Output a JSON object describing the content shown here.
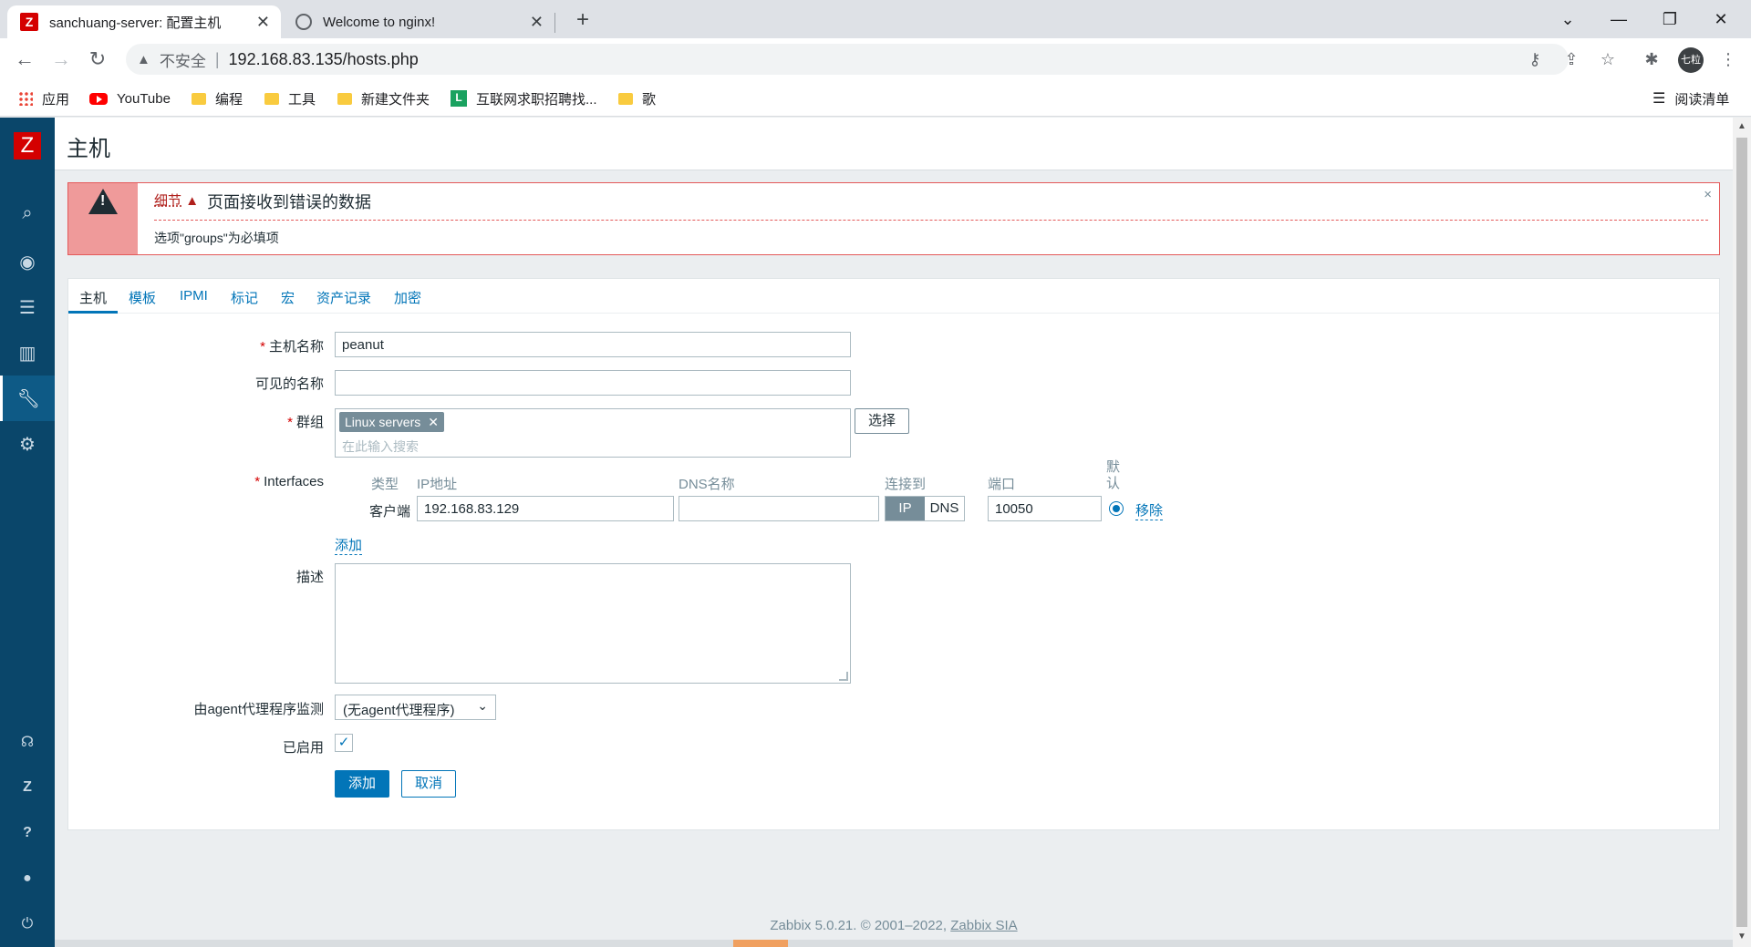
{
  "browser": {
    "tabs": [
      {
        "title": "sanchuang-server: 配置主机",
        "favicon": "zabbix-favicon",
        "active": true
      },
      {
        "title": "Welcome to nginx!",
        "favicon": "globe-icon",
        "active": false
      }
    ],
    "new_tab": "+",
    "address": {
      "security_label": "不安全",
      "separator": "|",
      "url": "192.168.83.135/hosts.php"
    },
    "profile_initials": "七粒",
    "bookmarks": [
      {
        "label": "应用",
        "icon": "apps-grid-icon"
      },
      {
        "label": "YouTube",
        "icon": "youtube-icon"
      },
      {
        "label": "编程",
        "icon": "folder-icon"
      },
      {
        "label": "工具",
        "icon": "folder-icon"
      },
      {
        "label": "新建文件夹",
        "icon": "folder-icon"
      },
      {
        "label": "互联网求职招聘找...",
        "icon": "liepin-icon"
      },
      {
        "label": "歌",
        "icon": "folder-icon"
      }
    ],
    "reading_list": "阅读清单"
  },
  "sidebar": {
    "logo": "Z",
    "items": [
      "search-icon",
      "monitoring-eye-icon",
      "inventory-list-icon",
      "reports-chart-icon",
      "configuration-wrench-icon",
      "administration-gear-icon"
    ],
    "bottom": [
      "support-icon",
      "share-icon",
      "help-icon",
      "user-icon",
      "logout-icon"
    ],
    "bottom_glyphs": {
      "share": "Z",
      "help": "?"
    }
  },
  "page": {
    "title": "主机"
  },
  "error": {
    "details_toggle": "细节",
    "details_arrow": "▲",
    "message": "页面接收到错误的数据",
    "detail": "选项\"groups\"为必填项",
    "close": "×"
  },
  "form": {
    "tabs": [
      "主机",
      "模板",
      "IPMI",
      "标记",
      "宏",
      "资产记录",
      "加密"
    ],
    "active_tab": 0,
    "required_mark": "*",
    "host_name": {
      "label": "主机名称",
      "value": "peanut"
    },
    "visible_name": {
      "label": "可见的名称",
      "value": ""
    },
    "groups": {
      "label": "群组",
      "selected": "Linux servers",
      "remove": "✕",
      "placeholder": "在此输入搜索",
      "select_button": "选择"
    },
    "interfaces": {
      "label": "Interfaces",
      "headers": {
        "type": "类型",
        "ip": "IP地址",
        "dns": "DNS名称",
        "connect": "连接到",
        "port": "端口",
        "default": "默认"
      },
      "rows": [
        {
          "type": "客户端",
          "ip": "192.168.83.129",
          "dns": "",
          "connect_options": [
            "IP",
            "DNS"
          ],
          "connect_selected": "IP",
          "port": "10050",
          "default": true,
          "remove": "移除"
        }
      ],
      "add": "添加"
    },
    "description": {
      "label": "描述",
      "value": ""
    },
    "proxy": {
      "label": "由agent代理程序监测",
      "value": "(无agent代理程序)"
    },
    "enabled": {
      "label": "已启用",
      "checked": true,
      "check_glyph": "✓"
    },
    "buttons": {
      "add": "添加",
      "cancel": "取消"
    }
  },
  "footer": {
    "text": "Zabbix 5.0.21. © 2001–2022, ",
    "link": "Zabbix SIA"
  },
  "colors": {
    "zabbix_red": "#d40000",
    "sidebar": "#0a466a",
    "link": "#0275b8",
    "error_border": "#e45959"
  }
}
